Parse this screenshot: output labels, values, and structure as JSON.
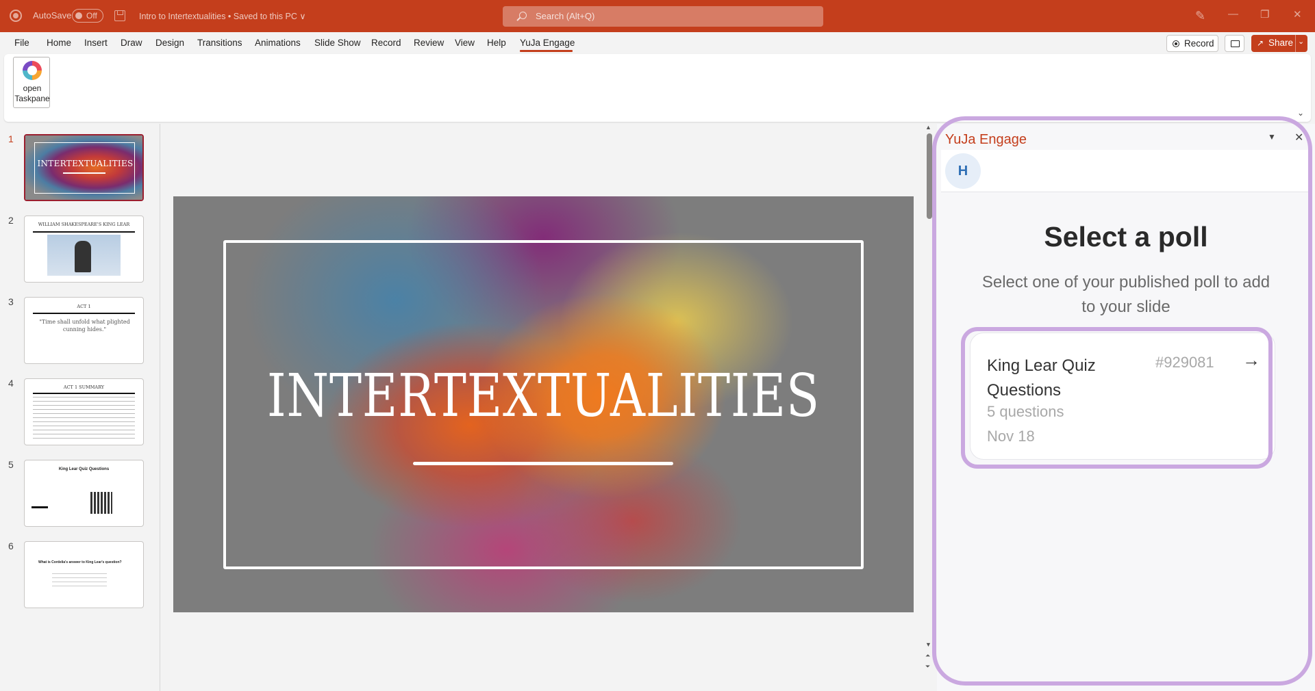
{
  "titlebar": {
    "autosave_label": "AutoSave",
    "autosave_state": "Off",
    "document_title": "Intro to Intertextualities • Saved to this PC ∨",
    "search_placeholder": "Search (Alt+Q)"
  },
  "menubar": {
    "items": [
      "File",
      "Home",
      "Insert",
      "Draw",
      "Design",
      "Transitions",
      "Animations",
      "Slide Show",
      "Record",
      "Review",
      "View",
      "Help",
      "YuJa Engage"
    ],
    "active": "YuJa Engage",
    "record_label": "Record",
    "share_label": "Share"
  },
  "ribbon": {
    "open_taskpane_label": "open Taskpane"
  },
  "thumbnails": [
    {
      "number": "1",
      "title": "INTERTEXTUALITIES",
      "selected": true
    },
    {
      "number": "2",
      "title": "WILLIAM SHAKESPEARE'S KING LEAR"
    },
    {
      "number": "3",
      "title": "ACT 1",
      "text": "\"Time shall unfold what plighted cunning hides.\""
    },
    {
      "number": "4",
      "title": "ACT 1 SUMMARY"
    },
    {
      "number": "5",
      "title": "King Lear Quiz Questions"
    },
    {
      "number": "6",
      "title": "What is Cordelia's answer to King Lear's question?"
    }
  ],
  "slide": {
    "title": "INTERTEXTUALITIES"
  },
  "taskpane": {
    "title": "YuJa Engage",
    "avatar_initial": "H",
    "heading": "Select a poll",
    "subheading": "Select one of your published poll to add to your slide",
    "poll": {
      "title": "King Lear Quiz Questions",
      "id": "#929081",
      "question_count": "5 questions",
      "date": "Nov 18"
    }
  },
  "colors": {
    "brand": "#c43e1c",
    "highlight": "#caa8e0",
    "selected_thumb_border": "#9b1e2e"
  }
}
